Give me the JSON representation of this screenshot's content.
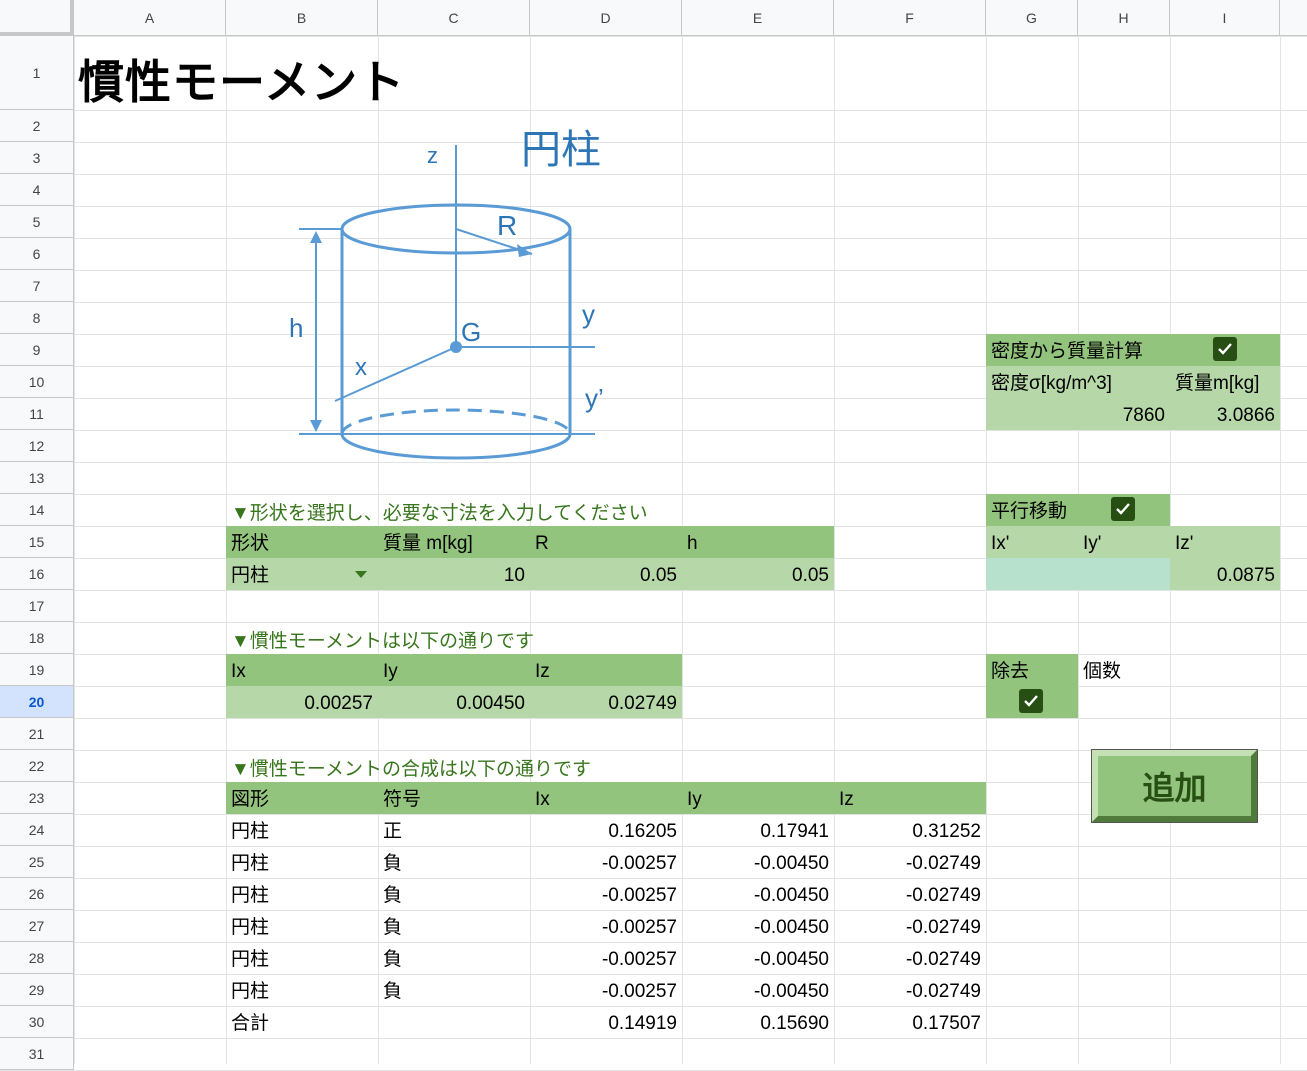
{
  "title": "慣性モーメント",
  "columns": [
    "A",
    "B",
    "C",
    "D",
    "E",
    "F",
    "G",
    "H",
    "I"
  ],
  "rows": [
    "1",
    "2",
    "3",
    "4",
    "5",
    "6",
    "7",
    "8",
    "9",
    "10",
    "11",
    "12",
    "13",
    "14",
    "15",
    "16",
    "17",
    "18",
    "19",
    "20",
    "21",
    "22",
    "23",
    "24",
    "25",
    "26",
    "27",
    "28",
    "29",
    "30",
    "31"
  ],
  "active_row": "20",
  "diagram": {
    "title": "円柱",
    "labels": {
      "z": "z",
      "R": "R",
      "h": "h",
      "G": "G",
      "y": "y",
      "x": "x",
      "yprime": "y’"
    }
  },
  "shape_input": {
    "note": "▼形状を選択し、必要な寸法を入力してください",
    "headers": [
      "形状",
      "質量 m[kg]",
      "R",
      "h"
    ],
    "values": [
      "円柱",
      "10",
      "0.05",
      "0.05"
    ]
  },
  "inertia": {
    "note": "▼慣性モーメントは以下の通りです",
    "headers": [
      "Ix",
      "Iy",
      "Iz"
    ],
    "values": [
      "0.00257",
      "0.00450",
      "0.02749"
    ]
  },
  "composite": {
    "note": "▼慣性モーメントの合成は以下の通りです",
    "headers": [
      "図形",
      "符号",
      "Ix",
      "Iy",
      "Iz"
    ],
    "rows": [
      [
        "円柱",
        "正",
        "0.16205",
        "0.17941",
        "0.31252"
      ],
      [
        "円柱",
        "負",
        "-0.00257",
        "-0.00450",
        "-0.02749"
      ],
      [
        "円柱",
        "負",
        "-0.00257",
        "-0.00450",
        "-0.02749"
      ],
      [
        "円柱",
        "負",
        "-0.00257",
        "-0.00450",
        "-0.02749"
      ],
      [
        "円柱",
        "負",
        "-0.00257",
        "-0.00450",
        "-0.02749"
      ],
      [
        "円柱",
        "負",
        "-0.00257",
        "-0.00450",
        "-0.02749"
      ],
      [
        "合計",
        "",
        "0.14919",
        "0.15690",
        "0.17507"
      ]
    ]
  },
  "density": {
    "label": "密度から質量計算",
    "checked": true,
    "density_label": "密度σ[kg/m^3]",
    "mass_label": "質量m[kg]",
    "density_value": "7860",
    "mass_value": "3.0866"
  },
  "parallel": {
    "label": "平行移動",
    "checked": true,
    "headers": [
      "Ix'",
      "Iy'",
      "Iz'"
    ],
    "values": [
      "",
      "",
      "0.0875"
    ]
  },
  "remove": {
    "label": "除去",
    "count_label": "個数",
    "checked": true
  },
  "add_button": "追加",
  "colors": {
    "accent_dark": "#93c47d",
    "accent_light": "#b6d7a8",
    "teal": "#b7e1cd",
    "diagram_blue": "#5b9bd5",
    "note_green": "#38761d"
  }
}
